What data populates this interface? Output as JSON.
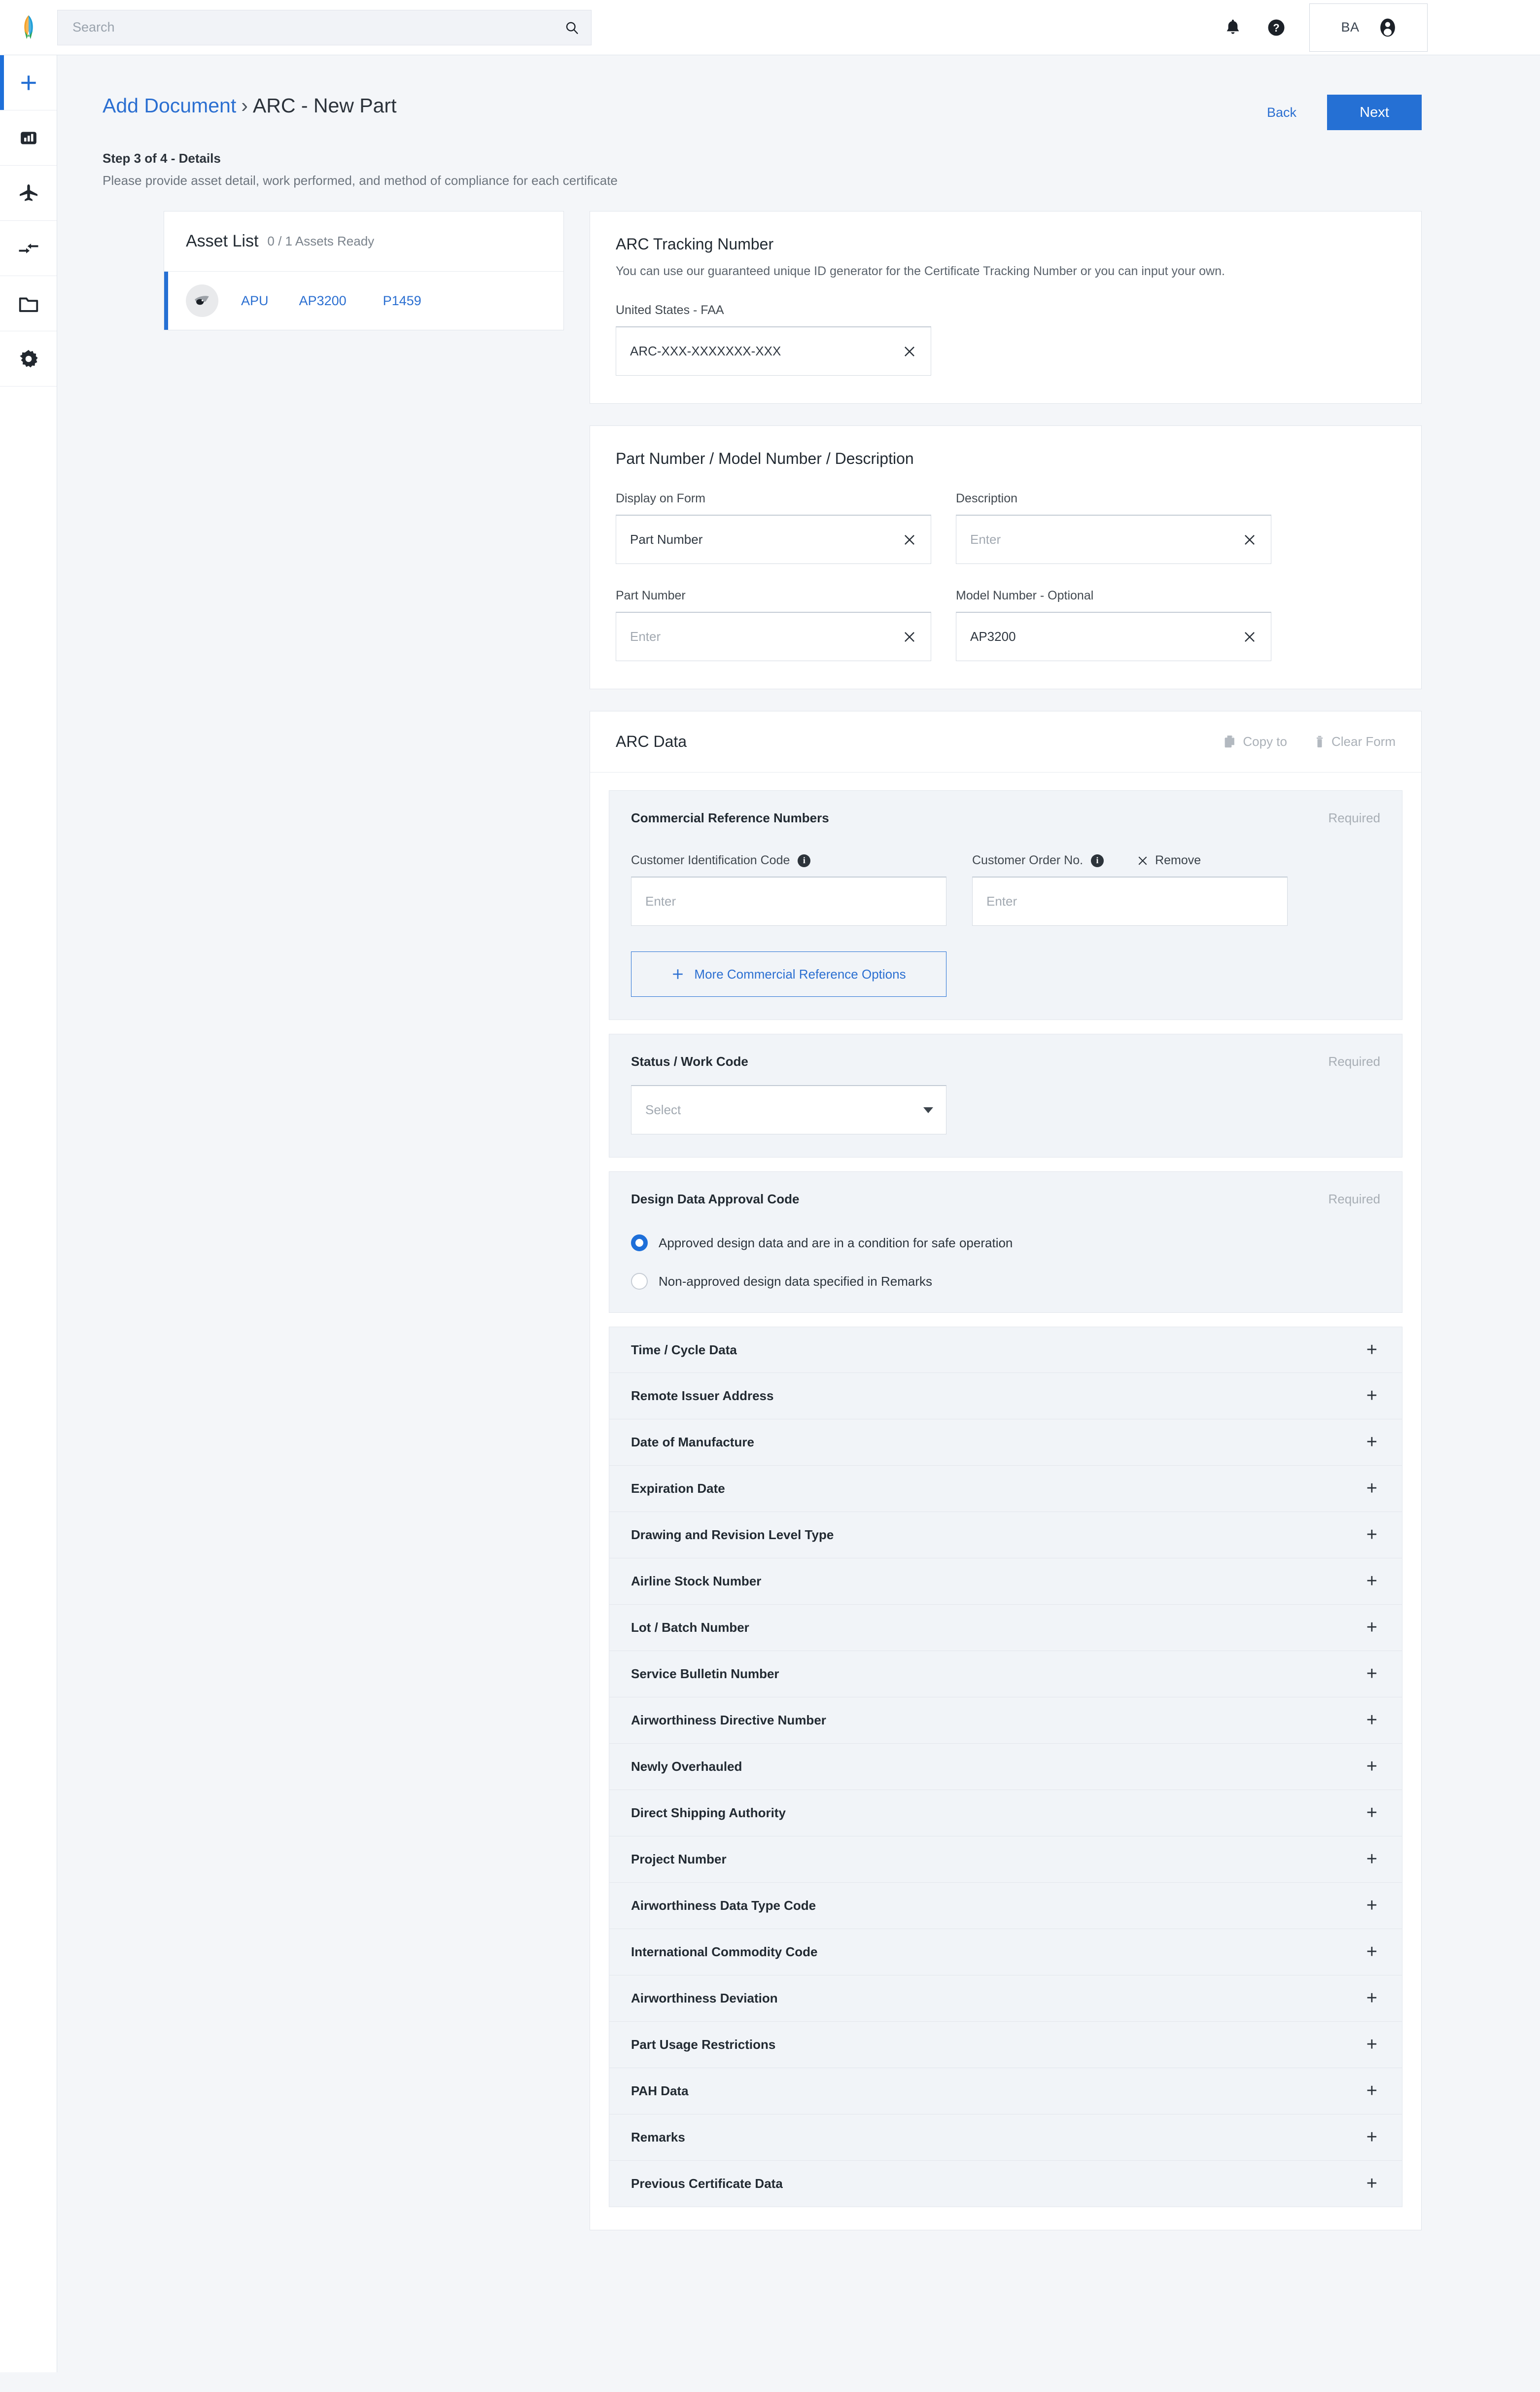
{
  "topbar": {
    "logo_name": "brand-logo",
    "search": {
      "placeholder": "Search",
      "value": ""
    },
    "notifications_icon": "bell-icon",
    "help_icon": "help-circle-icon",
    "account": {
      "initials": "BA",
      "avatar_icon": "user-avatar-icon"
    }
  },
  "sidebar": {
    "items": [
      {
        "icon": "plus-icon",
        "name": "add",
        "active": true
      },
      {
        "icon": "chart-bar-icon",
        "name": "dashboard",
        "active": false
      },
      {
        "icon": "airplane-icon",
        "name": "fleet",
        "active": false
      },
      {
        "icon": "transfer-arrows-icon",
        "name": "transfers",
        "active": false
      },
      {
        "icon": "folder-icon",
        "name": "documents",
        "active": false
      },
      {
        "icon": "gear-icon",
        "name": "settings",
        "active": false
      }
    ]
  },
  "header": {
    "breadcrumb_root": "Add Document",
    "breadcrumb_separator": "›",
    "breadcrumb_current": "ARC - New Part",
    "back_label": "Back",
    "next_label": "Next"
  },
  "step": {
    "title": "Step 3 of 4 - Details",
    "subtitle": "Please provide asset detail, work performed, and method of compliance for each certificate"
  },
  "asset_list": {
    "title": "Asset List",
    "count_label": "0 / 1 Assets Ready",
    "rows": [
      {
        "thumb_icon": "aircraft-part-icon",
        "col1": "APU",
        "col2": "AP3200",
        "col3": "P1459"
      }
    ]
  },
  "arc_tracking": {
    "title": "ARC Tracking Number",
    "description": "You can use our guaranteed unique ID generator for the Certificate Tracking Number or you can input your own.",
    "field_label": "United States - FAA",
    "field_value": "ARC-XXX-XXXXXXX-XXX",
    "field_placeholder": "Enter",
    "clear_icon": "close-icon"
  },
  "part_number_panel": {
    "title": "Part Number / Model Number / Description",
    "fields": [
      {
        "label": "Display on Form",
        "value": "Part Number",
        "placeholder": "Enter"
      },
      {
        "label": "Description",
        "value": "",
        "placeholder": "Enter"
      },
      {
        "label": "Part Number",
        "value": "",
        "placeholder": "Enter"
      },
      {
        "label": "Model Number - Optional",
        "value": "AP3200",
        "placeholder": "Enter"
      }
    ]
  },
  "arc_data": {
    "title": "ARC Data",
    "copy_to_label": "Copy to",
    "copy_to_icon": "copy-icon",
    "clear_form_label": "Clear Form",
    "clear_form_icon": "trash-icon",
    "commercial": {
      "title": "Commercial Reference Numbers",
      "required_label": "Required",
      "fields": [
        {
          "label": "Customer Identification Code",
          "placeholder": "Enter",
          "value": "",
          "info_icon": "info-icon"
        },
        {
          "label": "Customer Order No.",
          "placeholder": "Enter",
          "value": "",
          "info_icon": "info-icon"
        }
      ],
      "remove_label": "Remove",
      "remove_icon": "close-icon",
      "more_options_label": "More Commercial Reference Options",
      "more_options_icon": "plus-icon"
    },
    "status_work_code": {
      "title": "Status /  Work Code",
      "required_label": "Required",
      "select_placeholder": "Select",
      "caret_icon": "chevron-down-icon"
    },
    "design_data": {
      "title": "Design Data Approval Code",
      "required_label": "Required",
      "options": [
        {
          "label": "Approved design data and are in a condition for safe operation",
          "selected": true
        },
        {
          "label": "Non-approved design data specified in Remarks",
          "selected": false
        }
      ]
    },
    "accordions": [
      {
        "label": "Time / Cycle Data",
        "expand_icon": "plus-icon"
      },
      {
        "label": "Remote Issuer Address",
        "expand_icon": "plus-icon"
      },
      {
        "label": "Date of Manufacture",
        "expand_icon": "plus-icon"
      },
      {
        "label": "Expiration Date",
        "expand_icon": "plus-icon"
      },
      {
        "label": "Drawing and Revision Level Type",
        "expand_icon": "plus-icon"
      },
      {
        "label": "Airline Stock Number",
        "expand_icon": "plus-icon"
      },
      {
        "label": "Lot / Batch Number",
        "expand_icon": "plus-icon"
      },
      {
        "label": "Service Bulletin Number",
        "expand_icon": "plus-icon"
      },
      {
        "label": "Airworthiness Directive Number",
        "expand_icon": "plus-icon"
      },
      {
        "label": "Newly Overhauled",
        "expand_icon": "plus-icon"
      },
      {
        "label": "Direct Shipping Authority",
        "expand_icon": "plus-icon"
      },
      {
        "label": "Project Number",
        "expand_icon": "plus-icon"
      },
      {
        "label": "Airworthiness Data Type Code",
        "expand_icon": "plus-icon"
      },
      {
        "label": "International Commodity Code",
        "expand_icon": "plus-icon"
      },
      {
        "label": "Airworthiness Deviation",
        "expand_icon": "plus-icon"
      },
      {
        "label": "Part Usage Restrictions",
        "expand_icon": "plus-icon"
      },
      {
        "label": "PAH Data",
        "expand_icon": "plus-icon"
      },
      {
        "label": "Remarks",
        "expand_icon": "plus-icon"
      },
      {
        "label": "Previous Certificate Data",
        "expand_icon": "plus-icon"
      }
    ]
  },
  "colors": {
    "accent_blue": "#2570d4",
    "link_blue": "#2b6fd1",
    "page_bg": "#f4f6f9",
    "card_bg": "#ffffff",
    "subcard_bg": "#f1f4f8",
    "text_dark": "#222a32",
    "text_muted": "#7b838c"
  }
}
